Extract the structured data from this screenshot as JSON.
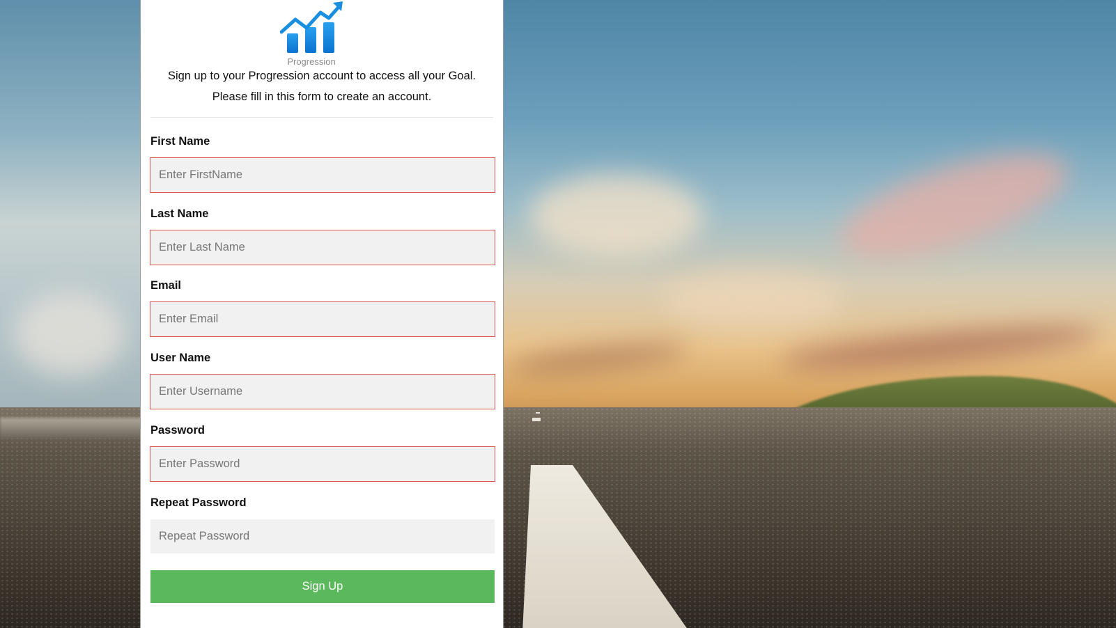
{
  "brand": {
    "logo_caption": "Progression",
    "logo_icon": "growth-chart-icon"
  },
  "intro": {
    "line1": "Sign up to your Progression account to access all your Goal.",
    "line2": "Please fill in this form to create an account."
  },
  "form": {
    "first_name": {
      "label": "First Name",
      "placeholder": "Enter FirstName",
      "value": ""
    },
    "last_name": {
      "label": "Last Name",
      "placeholder": "Enter Last Name",
      "value": ""
    },
    "email": {
      "label": "Email",
      "placeholder": "Enter Email",
      "value": ""
    },
    "username": {
      "label": "User Name",
      "placeholder": "Enter Username",
      "value": ""
    },
    "password": {
      "label": "Password",
      "placeholder": "Enter Password",
      "value": ""
    },
    "repeat_password": {
      "label": "Repeat Password",
      "placeholder": "Repeat Password",
      "value": ""
    },
    "submit_label": "Sign Up"
  },
  "colors": {
    "invalid_border": "#e05252",
    "submit_button": "#5cb85c",
    "logo_blue": "#1a8fe0"
  }
}
